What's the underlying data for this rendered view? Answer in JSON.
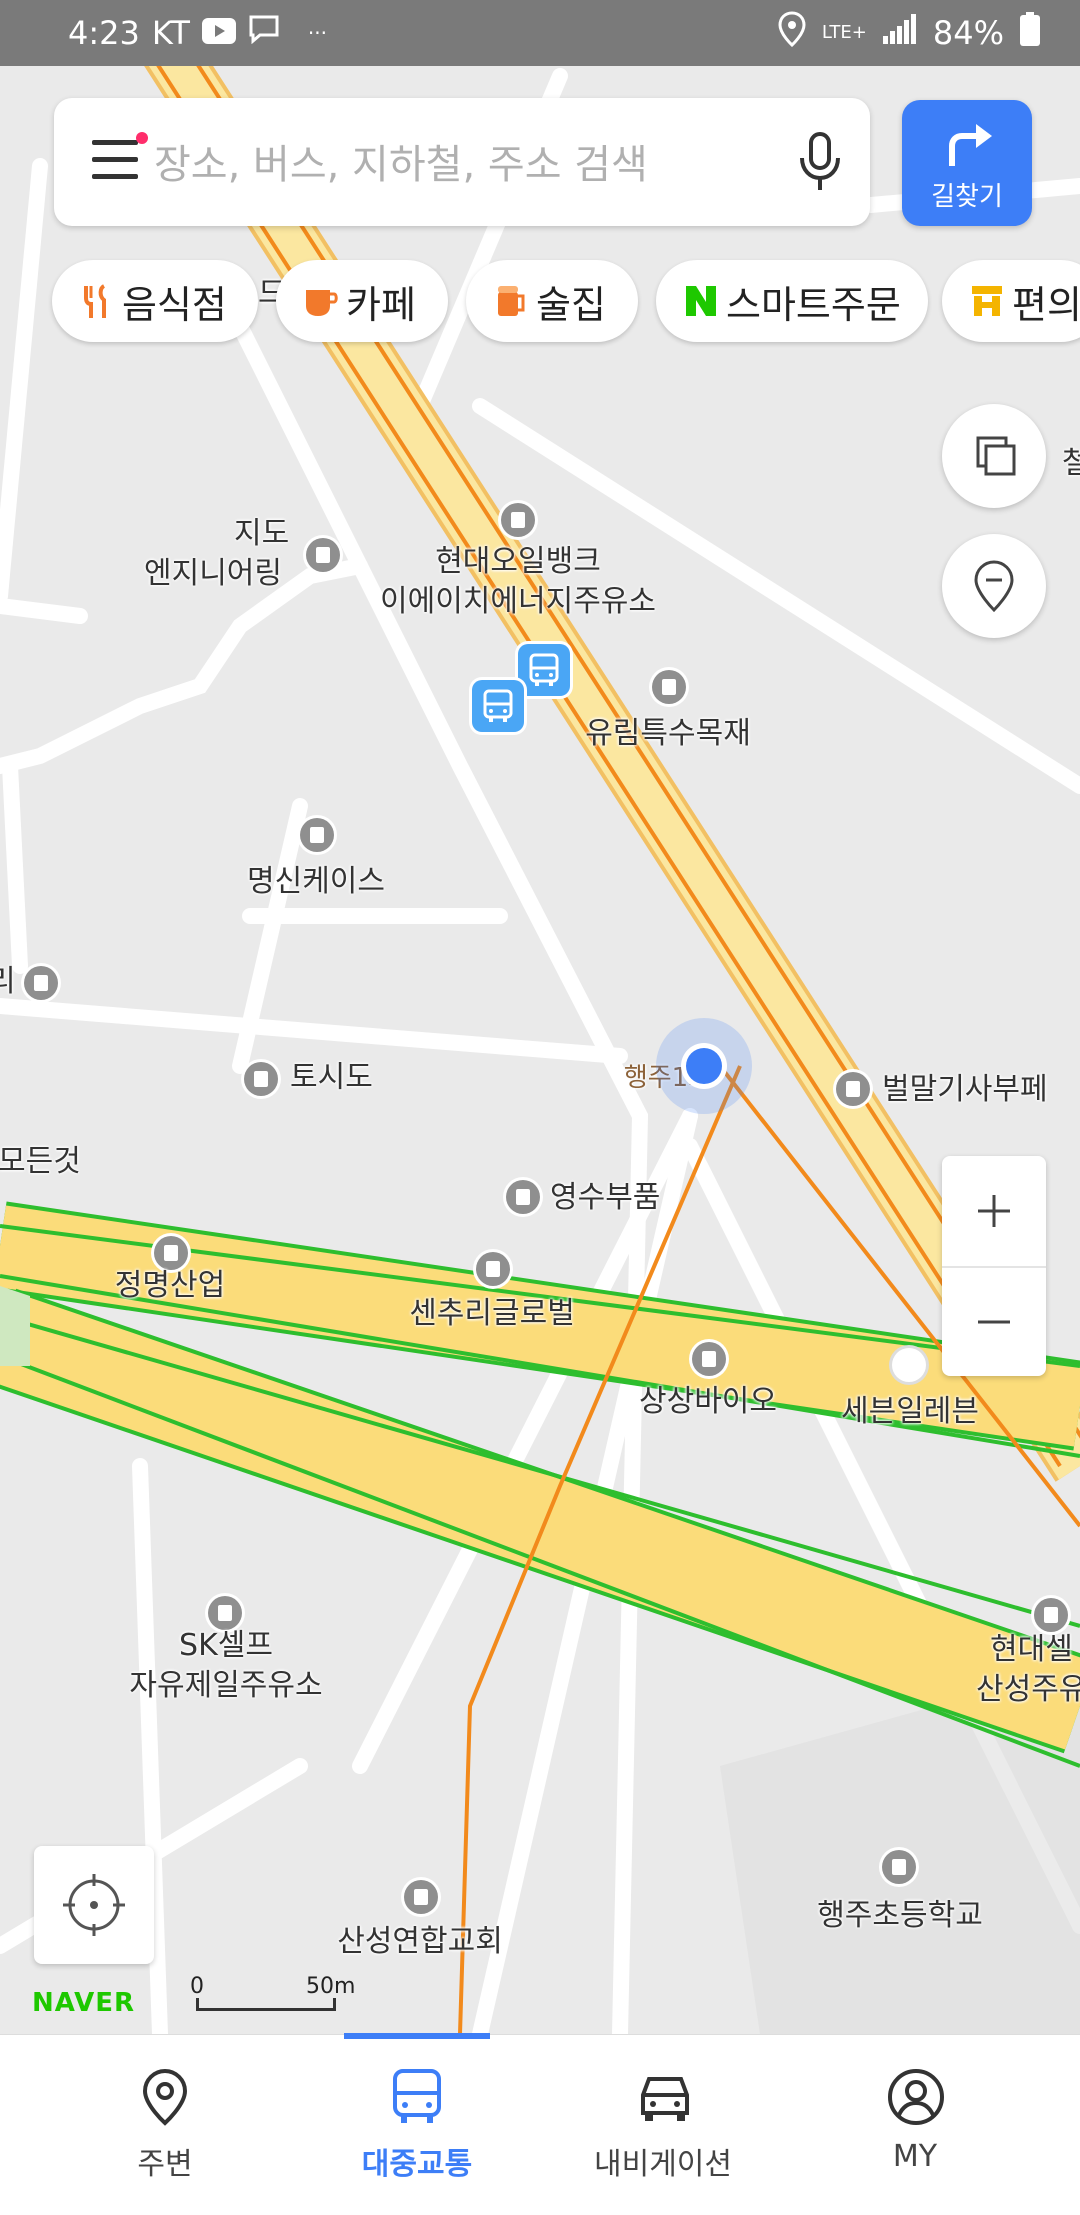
{
  "status_bar": {
    "time": "4:23",
    "carrier": "KT",
    "extra": "···",
    "network": "LTE+",
    "battery": "84%"
  },
  "search": {
    "placeholder": "장소, 버스, 지하철, 주소 검색",
    "route_button_label": "길찾기"
  },
  "chips": [
    {
      "label": "음식점",
      "icon": "fork-knife-icon"
    },
    {
      "label": "카페",
      "icon": "coffee-cup-icon"
    },
    {
      "label": "술집",
      "icon": "beer-mug-icon"
    },
    {
      "label": "스마트주문",
      "icon": "naver-n-icon"
    },
    {
      "label": "편의",
      "icon": "convenience-store-icon"
    }
  ],
  "map": {
    "labels": {
      "jido": "지도",
      "jido2": "엔지니어링",
      "hyundai_oil": "현대오일뱅크",
      "hyundai_oil2": "이에이치에너지주유소",
      "yurim": "유림특수목재",
      "myungshin": "명신케이스",
      "toshido": "토시도",
      "haengju_bridge": "행주1교",
      "beolmal": "벌말기사부페",
      "all_things": "모든것",
      "youngsu": "영수부품",
      "jungmyung": "정명산업",
      "century": "센추리글로벌",
      "sangsang": "상상바이오",
      "seven": "세븐일레븐",
      "sk_self": "SK셀프",
      "sk_self2": "자유제일주유소",
      "hyundai_self": "현대셀",
      "hyundai_self2": "산성주유",
      "sanseong_church": "산성연합교회",
      "haengju_school": "행주초등학교",
      "right_cut": "철",
      "top_cut": "드",
      "left_cut": "리"
    },
    "scale": {
      "zero": "0",
      "fifty": "50m"
    },
    "logo": "NAVER",
    "colors": {
      "road_major": "#fbdc7a",
      "road_orange": "#f28a1c",
      "road_green": "#2ebe2e",
      "accent": "#3d7ef7"
    }
  },
  "bottom_nav": [
    {
      "label": "주변",
      "icon": "location-pin-icon",
      "active": false
    },
    {
      "label": "대중교통",
      "icon": "bus-icon",
      "active": true
    },
    {
      "label": "내비게이션",
      "icon": "car-icon",
      "active": false
    },
    {
      "label": "MY",
      "icon": "profile-icon",
      "active": false
    }
  ]
}
